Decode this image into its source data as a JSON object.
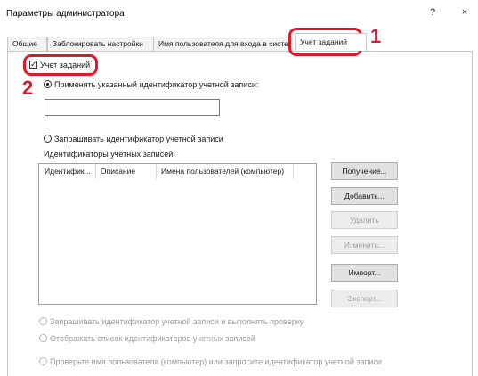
{
  "window": {
    "title": "Параметры администратора",
    "help_glyph": "?",
    "close_glyph": "×"
  },
  "tabs": [
    {
      "label": "Общие"
    },
    {
      "label": "Заблокировать настройки"
    },
    {
      "label": "Имя пользователя для входа в систем"
    },
    {
      "label": "Учет заданий",
      "active": true
    }
  ],
  "markers": {
    "one": "1",
    "two": "2"
  },
  "job_accounting": {
    "label": "Учет заданий",
    "checked": true,
    "check_glyph": "✓"
  },
  "options": {
    "apply_specified": "Применять указанный идентификатор учетной записи:",
    "apply_input_value": "",
    "request_id": "Запрашивать идентификатор учетной записи",
    "accounts_label": "Идентификаторы учетных записей:"
  },
  "accounts_table": {
    "columns": [
      "Идентифик...",
      "Описание",
      "Имена пользователей (компьютер)"
    ],
    "rows": []
  },
  "buttons": {
    "get": "Получение...",
    "add": "Добавить...",
    "delete": "Удалить",
    "edit": "Изменить...",
    "import": "Импорт...",
    "export": "Экспорт..."
  },
  "bottom_options": {
    "request_and_verify": "Запрашивать идентификатор учетной записи и выполнять проверку",
    "show_list": "Отображать список идентификаторов учетных записей",
    "check_user": "Проверьте имя пользователя (компьютер) или запросите идентификатор учетной записи"
  },
  "colors": {
    "highlight": "#e0192a",
    "disabled_text": "#9a9a9a"
  }
}
